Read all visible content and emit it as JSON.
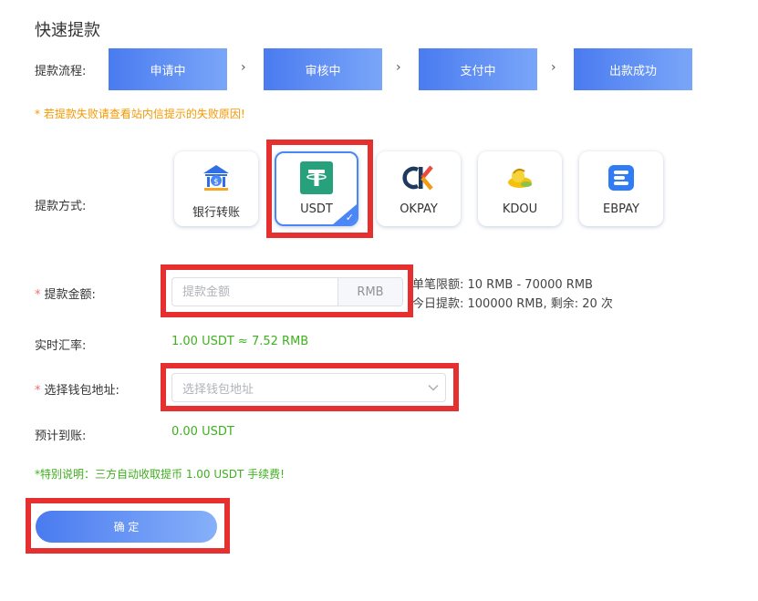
{
  "page": {
    "title": "快速提款"
  },
  "flow": {
    "label": "提款流程:",
    "steps": [
      "申请中",
      "审核中",
      "支付中",
      "出款成功"
    ],
    "arrow": "›"
  },
  "warning": "* 若提款失败请查看站内信提示的失败原因!",
  "methods": {
    "label": "提款方式:",
    "items": [
      {
        "label": "银行转账",
        "icon": "bank-icon"
      },
      {
        "label": "USDT",
        "icon": "tether-icon",
        "selected": true
      },
      {
        "label": "OKPAY",
        "icon": "okpay-icon"
      },
      {
        "label": "KDOU",
        "icon": "kdou-icon"
      },
      {
        "label": "EBPAY",
        "icon": "ebpay-icon"
      }
    ],
    "selected_check": "✓"
  },
  "amount": {
    "required_mark": "*",
    "label": "提款金额:",
    "placeholder": "提款金额",
    "value": "",
    "suffix": "RMB",
    "limit_single": "单笔限额: 10 RMB - 70000 RMB",
    "limit_daily": "今日提款: 100000 RMB, 剩余: 20 次"
  },
  "rate": {
    "label": "实时汇率:",
    "value": "1.00 USDT ≈ 7.52 RMB"
  },
  "wallet": {
    "required_mark": "*",
    "label": "选择钱包地址:",
    "placeholder": "选择钱包地址"
  },
  "expected": {
    "label": "预计到账:",
    "value": "0.00 USDT"
  },
  "note": "*特别说明：三方自动收取提币 1.00 USDT 手续费!",
  "submit": {
    "label": "确 定"
  },
  "colors": {
    "accent": "#4a86f5",
    "highlight_red": "#e5302f",
    "green": "#3fb01f",
    "warning_orange": "#f39800"
  }
}
